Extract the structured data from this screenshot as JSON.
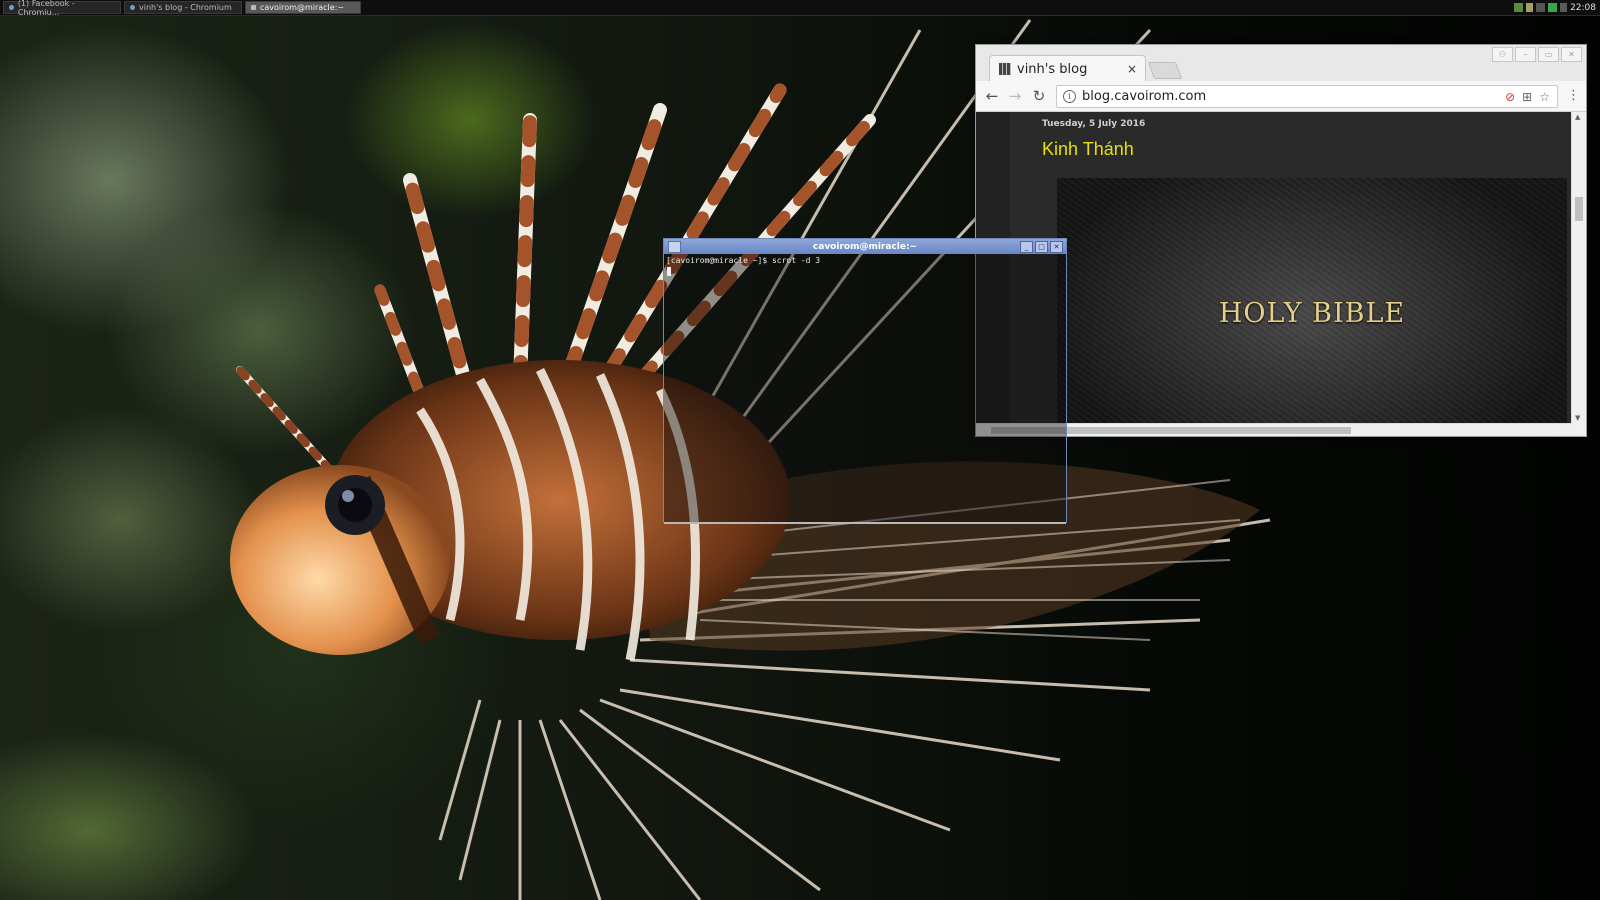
{
  "taskbar": {
    "tasks": [
      {
        "label": "(1) Facebook - Chromiu..."
      },
      {
        "label": "vinh's blog - Chromium"
      },
      {
        "label": "cavoirom@miracle:~"
      }
    ],
    "clock": "22:08"
  },
  "browser": {
    "tab_title": "vinh's blog",
    "tab_close": "×",
    "url": "blog.cavoirom.com",
    "page": {
      "post_date": "Tuesday, 5 July 2016",
      "post_title": "Kinh Thánh",
      "hero_text": "HOLY BIBLE"
    }
  },
  "terminal": {
    "title": "cavoirom@miracle:~",
    "prompt_line": "[cavoirom@miracle ~]$ scrot -d 3"
  },
  "colors": {
    "post_title": "#e8e000",
    "hero_text": "#e6cf86",
    "terminal_titlebar": "#7a96d0"
  }
}
